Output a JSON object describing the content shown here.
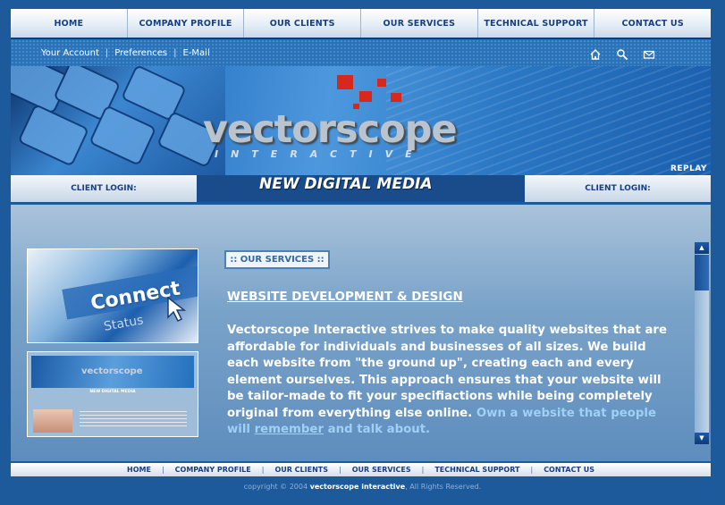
{
  "top_nav": {
    "items": [
      "HOME",
      "COMPANY PROFILE",
      "OUR CLIENTS",
      "OUR SERVICES",
      "TECHNICAL SUPPORT",
      "CONTACT US"
    ]
  },
  "sub_links": {
    "account": "Your Account",
    "preferences": "Preferences",
    "email": "E-Mail",
    "separator": "|"
  },
  "banner": {
    "logo_main": "vectorscope",
    "logo_sub": "INTERACTIVE",
    "tagline": "NEW DIGITAL MEDIA",
    "replay_label": "REPLAY"
  },
  "login": {
    "left_label": "CLIENT LOGIN:",
    "right_label": "CLIENT LOGIN:"
  },
  "thumbs": {
    "connect_word": "Connect",
    "status_word": "Status",
    "mini_logo": "vectorscope",
    "mini_tagline": "NEW DIGITAL MEDIA"
  },
  "content": {
    "badge": ":: OUR SERVICES ::",
    "heading": "WEBSITE DEVELOPMENT & DESIGN",
    "paragraph": "Vectorscope Interactive strives to make quality websites that are affordable for individuals and businesses of all sizes.  We build each website from \"the ground up\", creating each and every element ourselves. This approach ensures that your website will be tailor-made to fit your specifiactions while being completely original from everything else online.",
    "highlight_pre": "Own a website that people will",
    "highlight_link": "remember",
    "highlight_post": "and talk about."
  },
  "footer_nav": {
    "items": [
      "HOME",
      "COMPANY PROFILE",
      "OUR CLIENTS",
      "OUR SERVICES",
      "TECHNICAL SUPPORT",
      "CONTACT US"
    ],
    "separator": "|"
  },
  "copyright": {
    "prefix": "copyright © 2004",
    "company": "vectorscope interactive",
    "suffix": ", All Rights Reserved."
  },
  "colors": {
    "background": "#1c5a9c",
    "nav_text": "#163f86",
    "accent_red": "#d8281c",
    "highlight_text": "#9fd0f5"
  }
}
